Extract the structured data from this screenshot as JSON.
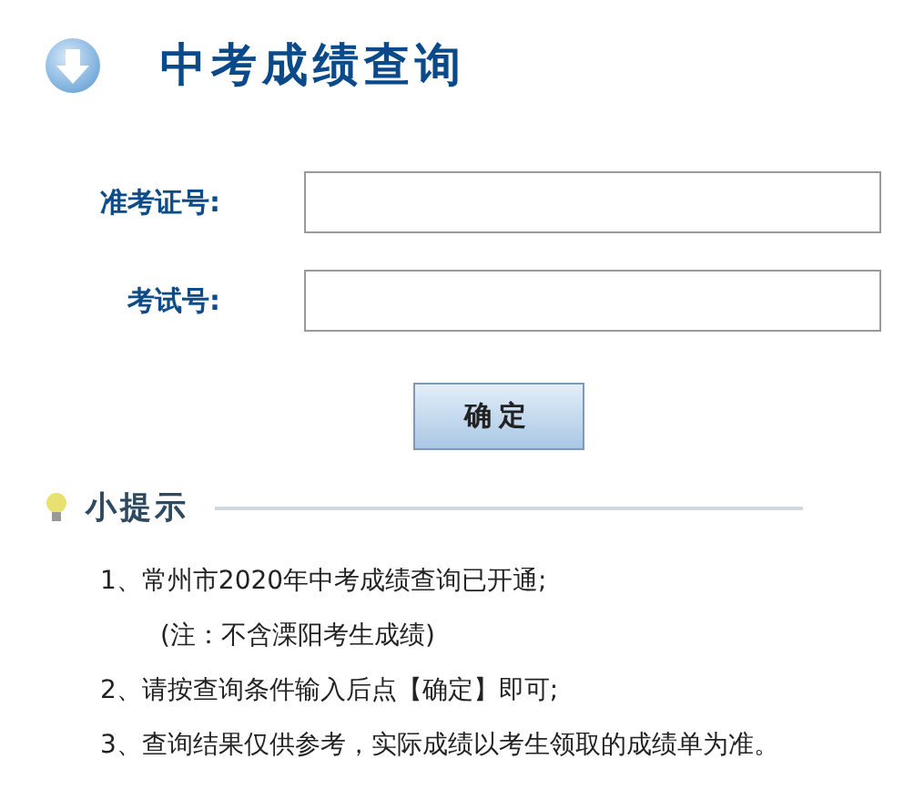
{
  "header": {
    "title": "中考成绩查询"
  },
  "form": {
    "fields": [
      {
        "label": "准考证号:"
      },
      {
        "label": "考试号:"
      }
    ],
    "submit": "确定"
  },
  "tips": {
    "title": "小提示",
    "items": [
      {
        "text": "1、常州市2020年中考成绩查询已开通;",
        "note": "(注：不含溧阳考生成绩)"
      },
      {
        "text": "2、请按查询条件输入后点【确定】即可;"
      },
      {
        "text": "3、查询结果仅供参考，实际成绩以考生领取的成绩单为准。"
      }
    ]
  }
}
